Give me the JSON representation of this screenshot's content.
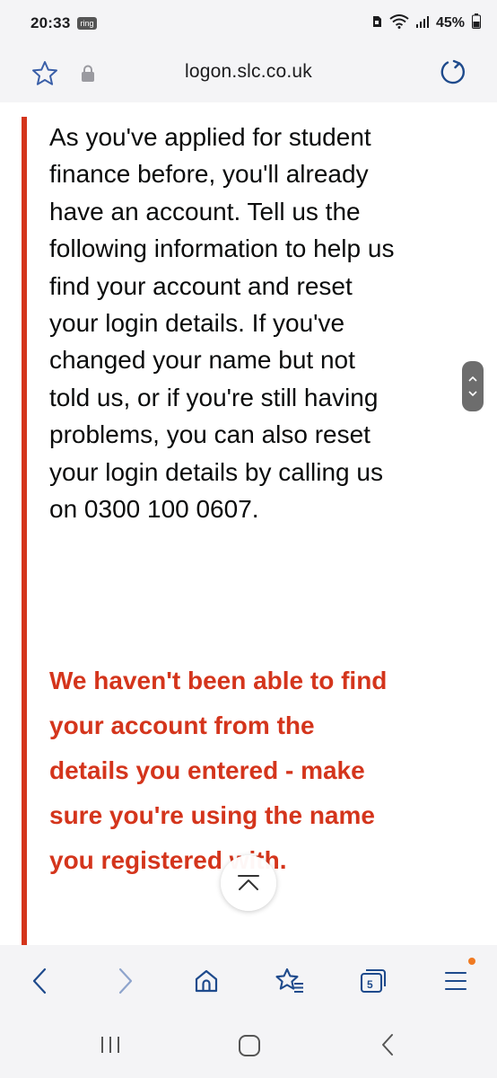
{
  "status_bar": {
    "time": "20:33",
    "ring_badge": "ring",
    "battery": "45%"
  },
  "address_bar": {
    "url": "logon.slc.co.uk"
  },
  "content": {
    "paragraph": "As you've applied for student finance before, you'll already have an account. Tell us the following information to help us find your account and reset your login details. If you've changed your name but not told us, or if you're still having problems, you can also reset your login details by calling us on 0300 100 0607.",
    "error_message": "We haven't been able to find your account from the details you entered - make sure you're using the name you registered with.",
    "accent_color": "#d4351c"
  },
  "toolbar": {
    "tab_count": "5",
    "icons": [
      "back-icon",
      "forward-icon",
      "home-icon",
      "bookmarks-icon",
      "tabs-icon",
      "menu-icon"
    ]
  },
  "navigation": {
    "icons": [
      "recents-icon",
      "home-icon",
      "back-icon"
    ]
  }
}
